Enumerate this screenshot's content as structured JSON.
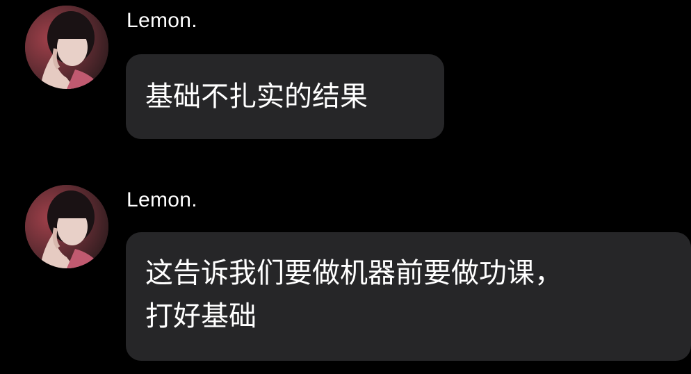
{
  "messages": [
    {
      "sender": "Lemon.",
      "avatar_icon": "user-avatar-photo",
      "text": "基础不扎实的结果"
    },
    {
      "sender": "Lemon.",
      "avatar_icon": "user-avatar-photo",
      "text": "这告诉我们要做机器前要做功课，\n打好基础"
    }
  ],
  "colors": {
    "background": "#000000",
    "bubble": "#262628",
    "text": "#ffffff"
  }
}
